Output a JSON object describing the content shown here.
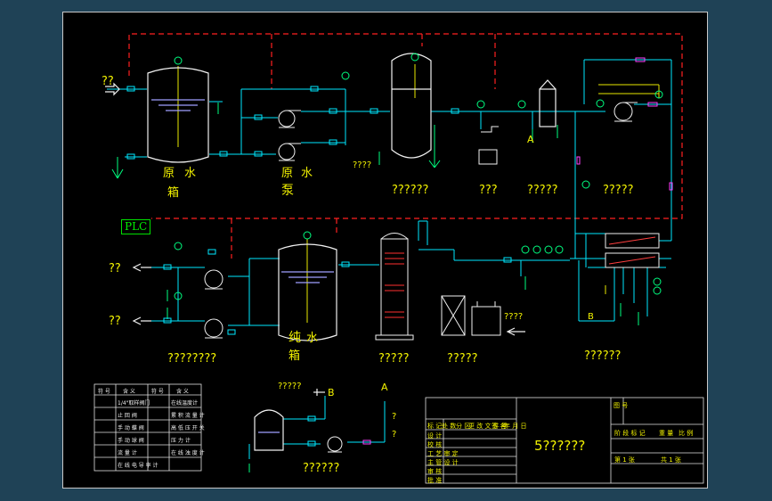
{
  "diagram": {
    "plc_label": "PLC",
    "labels": {
      "inlet": "??",
      "raw_tank_1": "原",
      "raw_tank_2": "水",
      "raw_tank_3": "箱",
      "raw_pump_1": "原",
      "raw_pump_2": "水",
      "raw_pump_3": "泵",
      "filter_caption_a": "????",
      "filter_caption_b": "??????",
      "dosing_caption": "???",
      "softener_caption": "?????",
      "highpump_caption": "?????",
      "outlet_1": "??",
      "outlet_2": "??",
      "pure_tank_1": "纯",
      "pure_tank_2": "水",
      "pure_tank_3": "箱",
      "pure_pumps_caption": "????????",
      "edi_caption": "?????",
      "box_caption": "?????",
      "box_side": "????",
      "ro_caption": "??????",
      "point_a": "A",
      "point_b": "B",
      "detail_top": "?????",
      "detail_b": "B",
      "detail_a": "A",
      "detail_q1": "?",
      "detail_q2": "?",
      "detail_caption": "??????"
    }
  },
  "legend": {
    "header": [
      "符 号",
      "含  义",
      "符 号",
      "含  义"
    ],
    "rows": [
      [
        "1/4\"取样阀门",
        "在线温度计"
      ],
      [
        "止 回 阀",
        "累 积 流 量 计"
      ],
      [
        "手 动 蝶 阀",
        "高 低 压 开 关"
      ],
      [
        "手 动 球 阀",
        "压 力 计"
      ],
      [
        "流 量 计",
        "在 线 浊 度 计"
      ],
      [
        "在 线 电 导 率 计",
        ""
      ]
    ]
  },
  "title_block": {
    "drawing_title": "5??????",
    "rows_left": [
      "标 记",
      "处 数",
      "分 区",
      "更 改 文 件 号",
      "签 名",
      "年 月 日"
    ],
    "role_rows": [
      "设 计",
      "校 核",
      "工 艺 审 定",
      "主 管 设 计",
      "审 核",
      "批 准"
    ],
    "right_header": [
      "阶 段 标 记",
      "重 量",
      "比 例"
    ],
    "sheet_info": [
      "第  1  张",
      "共  1  张"
    ],
    "code_label": "图 号"
  }
}
